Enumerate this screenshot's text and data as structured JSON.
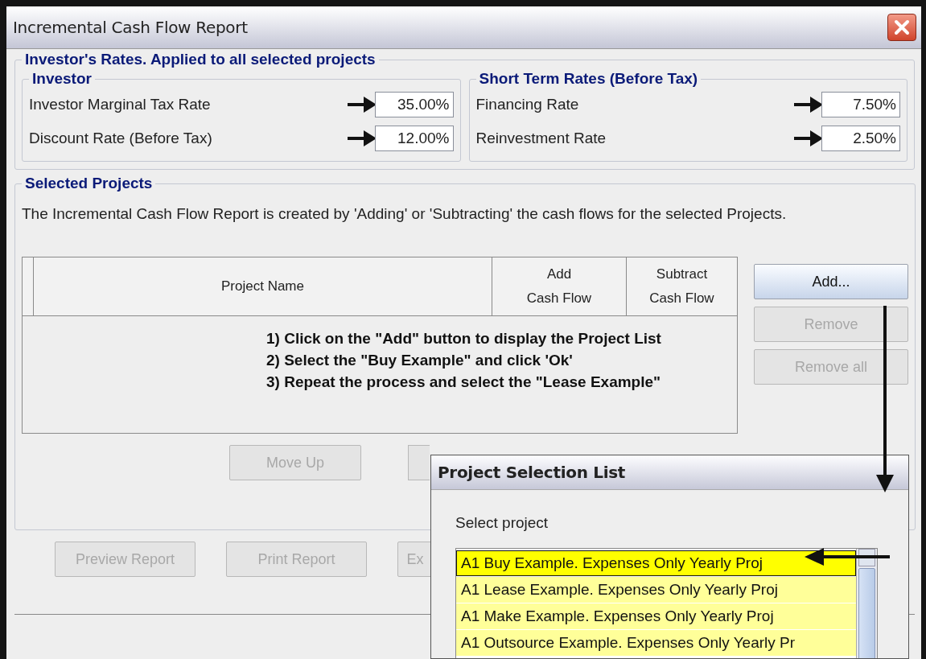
{
  "window": {
    "title": "Incremental Cash Flow Report"
  },
  "rates": {
    "title": "Investor's Rates. Applied to all selected projects",
    "groups": [
      {
        "title": "Investor",
        "rows": [
          {
            "label": "Investor Marginal Tax Rate",
            "value": "35.00%"
          },
          {
            "label": "Discount Rate (Before Tax)",
            "value": "12.00%"
          }
        ]
      },
      {
        "title": "Short Term Rates (Before Tax)",
        "rows": [
          {
            "label": "Financing Rate",
            "value": "7.50%"
          },
          {
            "label": "Reinvestment Rate",
            "value": "2.50%"
          }
        ]
      }
    ]
  },
  "selected_projects": {
    "title": "Selected Projects",
    "description": "The Incremental Cash Flow Report is created by 'Adding' or 'Subtracting' the cash flows for the selected Projects.",
    "table": {
      "columns": [
        [
          "Project Name"
        ],
        [
          "Add",
          "Cash Flow"
        ],
        [
          "Subtract",
          "Cash Flow"
        ]
      ]
    },
    "instructions": [
      "1) Click on the \"Add\" button to display the Project List",
      "2) Select the \"Buy Example\" and click 'Ok'",
      "3) Repeat the process and select the \"Lease Example\""
    ],
    "side_buttons": [
      {
        "label": "Add...",
        "disabled": false
      },
      {
        "label": "Remove",
        "disabled": true
      },
      {
        "label": "Remove all",
        "disabled": true
      }
    ],
    "move_buttons": [
      {
        "label": "Move Up",
        "disabled": true
      }
    ]
  },
  "report_buttons": [
    {
      "label": "Preview Report",
      "disabled": true
    },
    {
      "label": "Print Report",
      "disabled": true
    },
    {
      "label": "Ex",
      "disabled": true
    }
  ],
  "project_dialog": {
    "title": "Project Selection List",
    "prompt": "Select project",
    "items": [
      {
        "label": "A1 Buy Example. Expenses Only Yearly Proj",
        "selected": true
      },
      {
        "label": "A1 Lease Example. Expenses Only Yearly Proj",
        "selected": false
      },
      {
        "label": "A1 Make Example. Expenses Only Yearly Proj",
        "selected": false
      },
      {
        "label": "A1 Outsource Example. Expenses Only Yearly Pr",
        "selected": false
      }
    ]
  }
}
